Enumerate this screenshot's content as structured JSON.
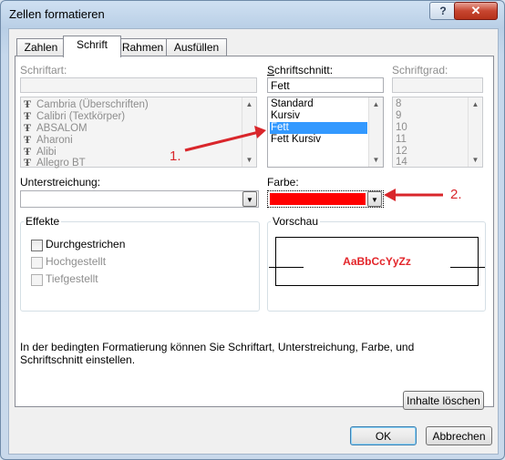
{
  "window": {
    "title": "Zellen formatieren",
    "help_label": "?",
    "close_label": "✕"
  },
  "tabs": [
    {
      "label": "Zahlen"
    },
    {
      "label": "Schrift"
    },
    {
      "label": "Rahmen"
    },
    {
      "label": "Ausfüllen"
    }
  ],
  "font": {
    "label": "Schriftart:",
    "value": "",
    "items": [
      "Cambria (Überschriften)",
      "Calibri (Textkörper)",
      "ABSALOM",
      "Aharoni",
      "Alibi",
      "Allegro BT"
    ]
  },
  "style": {
    "label": "Schriftschnitt:",
    "value": "Fett",
    "items": [
      "Standard",
      "Kursiv",
      "Fett",
      "Fett Kursiv"
    ],
    "selected": "Fett"
  },
  "size": {
    "label": "Schriftgrad:",
    "value": "",
    "items": [
      "8",
      "9",
      "10",
      "11",
      "12",
      "14"
    ]
  },
  "underline": {
    "label": "Unterstreichung:",
    "value": ""
  },
  "color": {
    "label": "Farbe:",
    "value_color": "#ff0000"
  },
  "effects": {
    "label": "Effekte",
    "strikethrough": "Durchgestrichen",
    "superscript": "Hochgestellt",
    "subscript": "Tiefgestellt"
  },
  "preview": {
    "label": "Vorschau",
    "sample": "AaBbCcYyZz",
    "sample_color": "#e3262b"
  },
  "info_text": "In der bedingten Formatierung können Sie Schriftart, Unterstreichung, Farbe, und Schriftschnitt einstellen.",
  "buttons": {
    "clear": "Inhalte löschen",
    "ok": "OK",
    "cancel": "Abbrechen"
  },
  "annotations": {
    "one": "1.",
    "two": "2.",
    "accent_color": "#d9262b"
  }
}
